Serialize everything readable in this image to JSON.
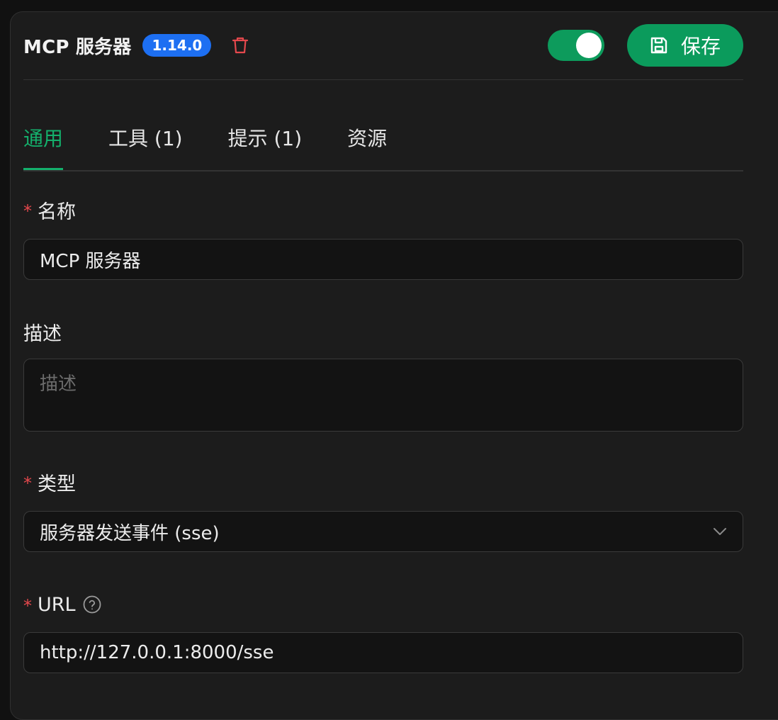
{
  "header": {
    "title": "MCP 服务器",
    "version": "1.14.0",
    "save_label": "保存",
    "enabled": true
  },
  "tabs": [
    {
      "label": "通用",
      "active": true
    },
    {
      "label": "工具 (1)",
      "active": false
    },
    {
      "label": "提示 (1)",
      "active": false
    },
    {
      "label": "资源",
      "active": false
    }
  ],
  "form": {
    "name": {
      "label": "名称",
      "required": true,
      "value": "MCP 服务器"
    },
    "description": {
      "label": "描述",
      "required": false,
      "value": "",
      "placeholder": "描述"
    },
    "type": {
      "label": "类型",
      "required": true,
      "value": "服务器发送事件 (sse)"
    },
    "url": {
      "label": "URL",
      "required": true,
      "value": "http://127.0.0.1:8000/sse"
    }
  },
  "colors": {
    "accent": "#0b9b5c",
    "badge": "#1d6ff2",
    "danger": "#e5484d"
  },
  "icons": [
    "trash-icon",
    "floppy-disk-icon",
    "chevron-down-icon",
    "help-circle-icon"
  ]
}
